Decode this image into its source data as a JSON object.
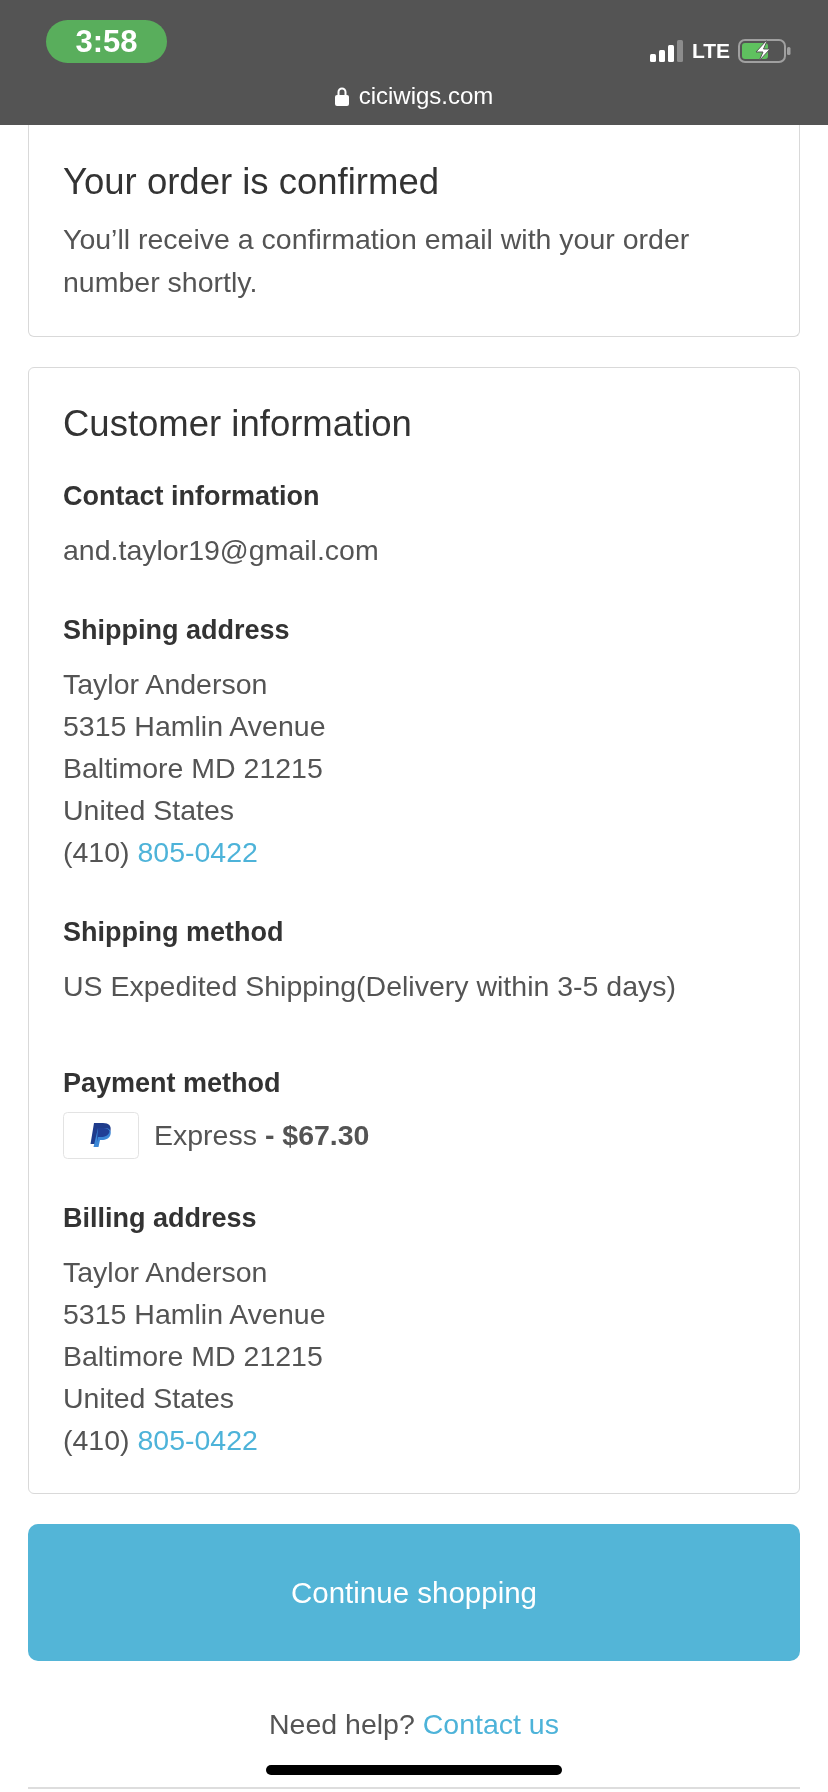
{
  "status_bar": {
    "time": "3:58",
    "network": "LTE",
    "url": "ciciwigs.com"
  },
  "confirmation": {
    "title": "Your order is confirmed",
    "message": "You’ll receive a confirmation email with your order number shortly."
  },
  "customer_information": {
    "title": "Customer information",
    "sections": [
      {
        "kind": "lines",
        "heading": "Contact information",
        "lines": [
          {
            "text": "and.taylor19@gmail.com"
          }
        ]
      },
      {
        "kind": "lines",
        "heading": "Shipping address",
        "lines": [
          {
            "text": "Taylor Anderson"
          },
          {
            "text": "5315 Hamlin Avenue"
          },
          {
            "text": "Baltimore MD 21215"
          },
          {
            "text": "United States"
          },
          {
            "text": "(410)",
            "link": "805-0422"
          }
        ]
      },
      {
        "kind": "text",
        "heading": "Shipping method",
        "text": "US Expedited Shipping(Delivery within 3-5 days)"
      },
      {
        "kind": "payment",
        "heading": "Payment method",
        "text": "Express **- $67.30**"
      },
      {
        "kind": "lines",
        "heading": "Billing address",
        "lines": [
          {
            "text": "Taylor Anderson"
          },
          {
            "text": "5315 Hamlin Avenue"
          },
          {
            "text": "Baltimore MD 21215"
          },
          {
            "text": "United States"
          },
          {
            "text": "(410)",
            "link": "805-0422"
          }
        ]
      }
    ]
  },
  "continue_button": "Continue shopping",
  "help": {
    "text": "Need help?",
    "link": "Contact us"
  }
}
